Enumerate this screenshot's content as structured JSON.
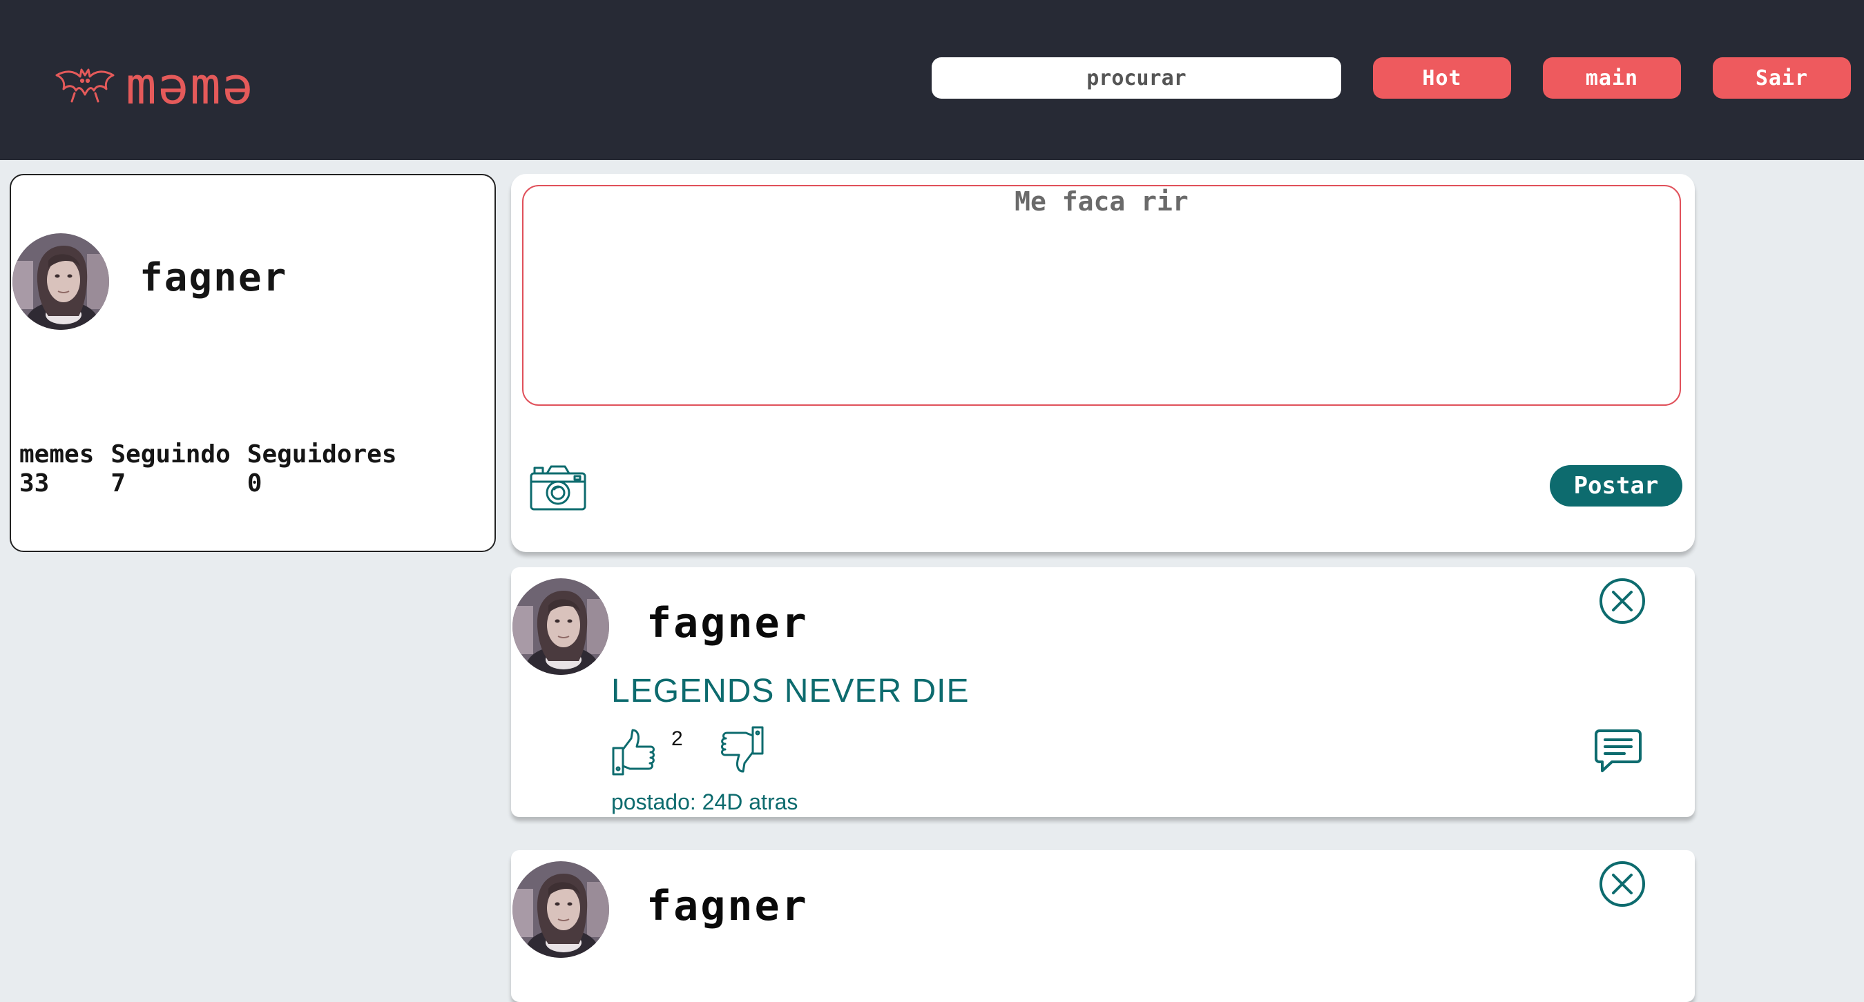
{
  "header": {
    "logo_text": "məmə",
    "search": {
      "placeholder": "procurar",
      "value": ""
    },
    "nav": {
      "hot_label": "Hot",
      "main_label": "main",
      "logout_label": "Sair"
    }
  },
  "profile": {
    "username": "fagner",
    "stats": [
      {
        "label": "memes",
        "value": "33"
      },
      {
        "label": "Seguindo",
        "value": "7"
      },
      {
        "label": "Seguidores",
        "value": "0"
      }
    ]
  },
  "compose": {
    "placeholder": "Me faca rir",
    "value": "",
    "post_label": "Postar"
  },
  "posts": [
    {
      "author": "fagner",
      "text": "LEGENDS NEVER DIE",
      "likes": "2",
      "date": "postado: 24D atras"
    },
    {
      "author": "fagner"
    }
  ],
  "colors": {
    "header_bg": "#272a35",
    "accent_red": "#ee5a5e",
    "accent_teal": "#0d6b6e",
    "page_bg": "#e8ecef"
  },
  "icons": {
    "logo": "bat-icon",
    "camera": "camera-icon",
    "close": "close-circle-icon",
    "like": "thumbs-up-icon",
    "dislike": "thumbs-down-icon",
    "comment": "comment-icon"
  }
}
